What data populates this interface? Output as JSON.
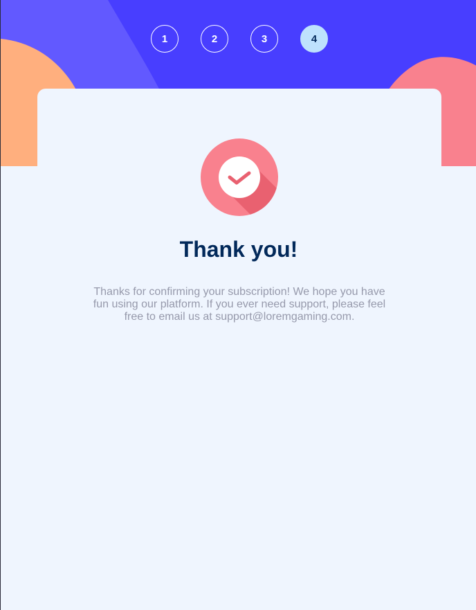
{
  "steps": [
    {
      "number": "1",
      "active": false
    },
    {
      "number": "2",
      "active": false
    },
    {
      "number": "3",
      "active": false
    },
    {
      "number": "4",
      "active": true
    }
  ],
  "confirmation": {
    "title": "Thank you!",
    "message": "Thanks for confirming your subscription! We hope you have fun using our platform. If you ever need support, please feel free to email us at support@loremgaming.com.",
    "icon": "checkmark-icon"
  },
  "colors": {
    "header_blue": "#483eff",
    "header_purple": "#6259ff",
    "blob_orange": "#ffaf7e",
    "blob_pink": "#f9818e",
    "background": "#eff5fe",
    "title": "#02295a",
    "text_grey": "#9699ab",
    "active_step": "#bee2fd"
  }
}
